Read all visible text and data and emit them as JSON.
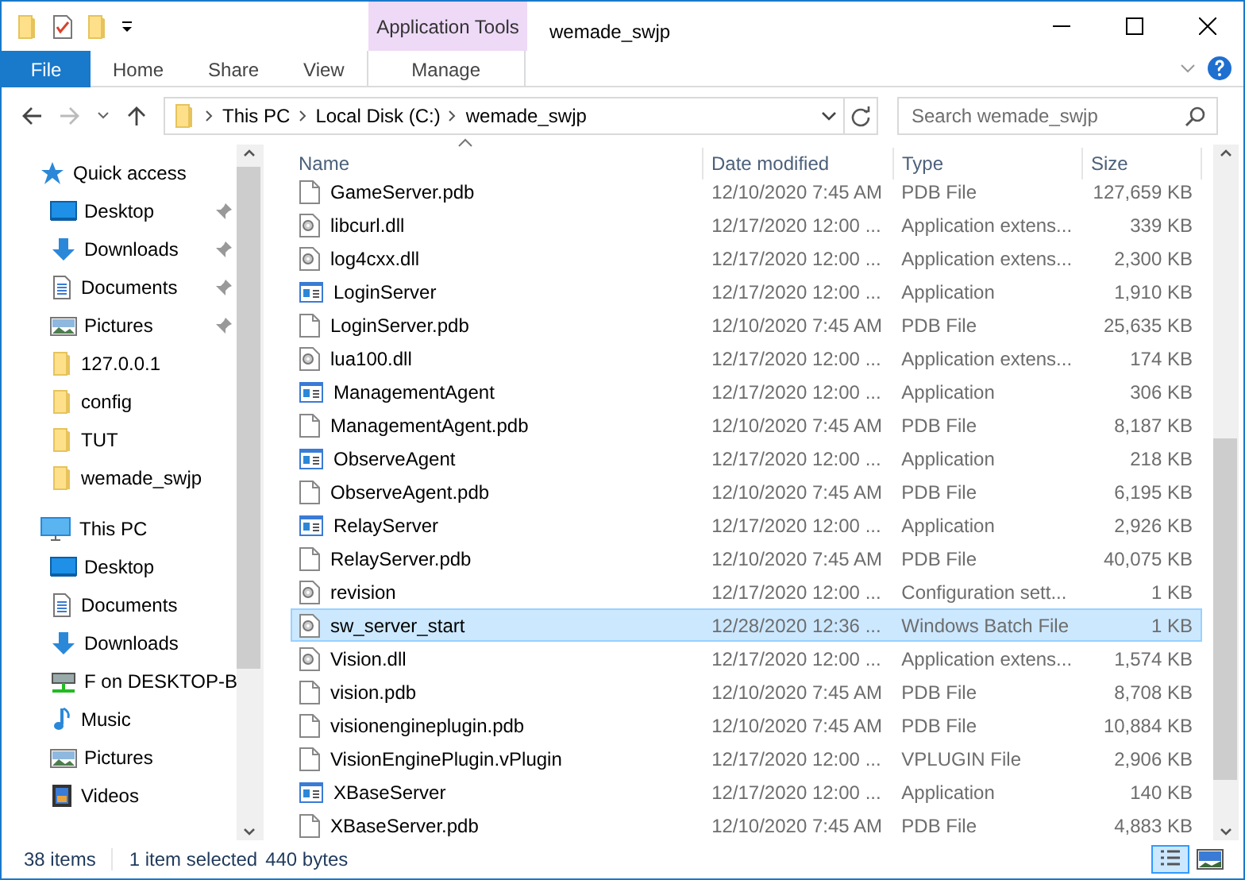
{
  "window": {
    "title": "wemade_swjp",
    "context_tab_group": "Application Tools"
  },
  "ribbon": {
    "tabs": [
      {
        "label": "File",
        "kind": "file",
        "selected": false
      },
      {
        "label": "Home",
        "kind": "tab",
        "selected": false
      },
      {
        "label": "Share",
        "kind": "tab",
        "selected": false
      },
      {
        "label": "View",
        "kind": "tab",
        "selected": false
      },
      {
        "label": "Manage",
        "kind": "context",
        "selected": false
      }
    ]
  },
  "address": {
    "crumbs": [
      "This PC",
      "Local Disk (C:)",
      "wemade_swjp"
    ],
    "forward_disabled": true
  },
  "search": {
    "placeholder": "Search wemade_swjp"
  },
  "sidebar": {
    "items": [
      {
        "label": "Quick access",
        "kind": "star",
        "children": [
          {
            "label": "Desktop",
            "kind": "desktop",
            "pinned": true
          },
          {
            "label": "Downloads",
            "kind": "downloads",
            "pinned": true
          },
          {
            "label": "Documents",
            "kind": "documents",
            "pinned": true
          },
          {
            "label": "Pictures",
            "kind": "pictures",
            "pinned": true
          },
          {
            "label": "127.0.0.1",
            "kind": "folder",
            "pinned": false
          },
          {
            "label": "config",
            "kind": "folder",
            "pinned": false
          },
          {
            "label": "TUT",
            "kind": "folder",
            "pinned": false
          },
          {
            "label": "wemade_swjp",
            "kind": "folder",
            "pinned": false
          }
        ]
      },
      {
        "label": "This PC",
        "kind": "pc",
        "children": [
          {
            "label": "Desktop",
            "kind": "desktop",
            "pinned": false
          },
          {
            "label": "Documents",
            "kind": "documents",
            "pinned": false
          },
          {
            "label": "Downloads",
            "kind": "downloads",
            "pinned": false
          },
          {
            "label": "F on DESKTOP-B",
            "kind": "network",
            "pinned": false
          },
          {
            "label": "Music",
            "kind": "music",
            "pinned": false
          },
          {
            "label": "Pictures",
            "kind": "pictures",
            "pinned": false
          },
          {
            "label": "Videos",
            "kind": "videos",
            "pinned": false
          }
        ]
      }
    ]
  },
  "table": {
    "columns": [
      "Name",
      "Date modified",
      "Type",
      "Size"
    ],
    "rows": [
      {
        "name": "GameServer.pdb",
        "date": "12/10/2020 7:45 AM",
        "type": "PDB File",
        "size": "127,659 KB",
        "kind": "document",
        "selected": false
      },
      {
        "name": "libcurl.dll",
        "date": "12/17/2020 12:00 ...",
        "type": "Application extens...",
        "size": "339 KB",
        "kind": "library",
        "selected": false
      },
      {
        "name": "log4cxx.dll",
        "date": "12/17/2020 12:00 ...",
        "type": "Application extens...",
        "size": "2,300 KB",
        "kind": "library",
        "selected": false
      },
      {
        "name": "LoginServer",
        "date": "12/17/2020 12:00 ...",
        "type": "Application",
        "size": "1,910 KB",
        "kind": "application",
        "selected": false
      },
      {
        "name": "LoginServer.pdb",
        "date": "12/10/2020 7:45 AM",
        "type": "PDB File",
        "size": "25,635 KB",
        "kind": "document",
        "selected": false
      },
      {
        "name": "lua100.dll",
        "date": "12/17/2020 12:00 ...",
        "type": "Application extens...",
        "size": "174 KB",
        "kind": "library",
        "selected": false
      },
      {
        "name": "ManagementAgent",
        "date": "12/17/2020 12:00 ...",
        "type": "Application",
        "size": "306 KB",
        "kind": "application",
        "selected": false
      },
      {
        "name": "ManagementAgent.pdb",
        "date": "12/10/2020 7:45 AM",
        "type": "PDB File",
        "size": "8,187 KB",
        "kind": "document",
        "selected": false
      },
      {
        "name": "ObserveAgent",
        "date": "12/17/2020 12:00 ...",
        "type": "Application",
        "size": "218 KB",
        "kind": "application",
        "selected": false
      },
      {
        "name": "ObserveAgent.pdb",
        "date": "12/10/2020 7:45 AM",
        "type": "PDB File",
        "size": "6,195 KB",
        "kind": "document",
        "selected": false
      },
      {
        "name": "RelayServer",
        "date": "12/17/2020 12:00 ...",
        "type": "Application",
        "size": "2,926 KB",
        "kind": "application",
        "selected": false
      },
      {
        "name": "RelayServer.pdb",
        "date": "12/10/2020 7:45 AM",
        "type": "PDB File",
        "size": "40,075 KB",
        "kind": "document",
        "selected": false
      },
      {
        "name": "revision",
        "date": "12/17/2020 12:00 ...",
        "type": "Configuration sett...",
        "size": "1 KB",
        "kind": "library",
        "selected": false
      },
      {
        "name": "sw_server_start",
        "date": "12/28/2020 12:36 ...",
        "type": "Windows Batch File",
        "size": "1 KB",
        "kind": "library",
        "selected": true
      },
      {
        "name": "Vision.dll",
        "date": "12/17/2020 12:00 ...",
        "type": "Application extens...",
        "size": "1,574 KB",
        "kind": "library",
        "selected": false
      },
      {
        "name": "vision.pdb",
        "date": "12/10/2020 7:45 AM",
        "type": "PDB File",
        "size": "8,708 KB",
        "kind": "document",
        "selected": false
      },
      {
        "name": "visionengineplugin.pdb",
        "date": "12/10/2020 7:45 AM",
        "type": "PDB File",
        "size": "10,884 KB",
        "kind": "document",
        "selected": false
      },
      {
        "name": "VisionEnginePlugin.vPlugin",
        "date": "12/17/2020 12:00 ...",
        "type": "VPLUGIN File",
        "size": "2,906 KB",
        "kind": "document",
        "selected": false
      },
      {
        "name": "XBaseServer",
        "date": "12/17/2020 12:00 ...",
        "type": "Application",
        "size": "140 KB",
        "kind": "application",
        "selected": false
      },
      {
        "name": "XBaseServer.pdb",
        "date": "12/10/2020 7:45 AM",
        "type": "PDB File",
        "size": "4,883 KB",
        "kind": "document",
        "selected": false
      }
    ]
  },
  "status_bar": {
    "item_count": "38 items",
    "selection": "1 item selected",
    "selection_size": "440 bytes",
    "views": [
      {
        "kind": "details",
        "selected": true
      },
      {
        "kind": "large_icons",
        "selected": false
      }
    ]
  }
}
